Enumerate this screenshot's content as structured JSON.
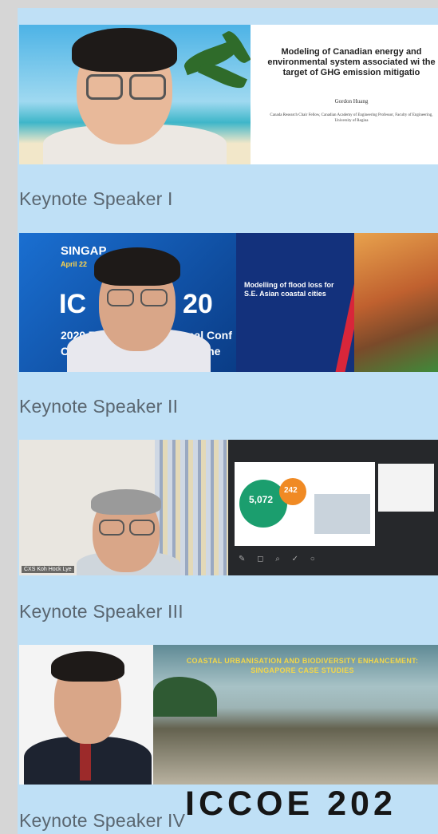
{
  "cards": [
    {
      "label": "Keynote Speaker I",
      "slide_title": "Modeling of Canadian energy and environmental system associated wi the target of GHG emission mitigatio",
      "slide_author": "Gordon Huang",
      "slide_affiliation": "Canada Research Chair Fellow, Canadian Academy of Engineering Professor, Faculty of Engineering, University of Regina"
    },
    {
      "label": "Keynote Speaker II",
      "banner_city": "SINGAP",
      "banner_date": "April 22",
      "banner_abbr_left": "IC",
      "banner_year_right": "20",
      "banner_line1": "2020 7t",
      "banner_line1b": "ational Conf",
      "banner_line2": "Coas",
      "banner_line2b": "cean Engine",
      "slide_title": "Modelling of flood loss for S.E. Asian coastal cities"
    },
    {
      "label": "Keynote Speaker III",
      "stat_value": "5,072",
      "stat_value2": "242",
      "name_tag": "CXS Koh Hock Lye"
    },
    {
      "label": "Keynote Speaker IV",
      "slide_title": "COASTAL URBANISATION AND BIODIVERSITY ENHANCEMENT: SINGAPORE CASE STUDIES"
    }
  ],
  "watermark": "ICCOE 202",
  "colors": {
    "panel": "#bfe0f6",
    "page": "#d6d6d6",
    "label": "#5a6670"
  }
}
